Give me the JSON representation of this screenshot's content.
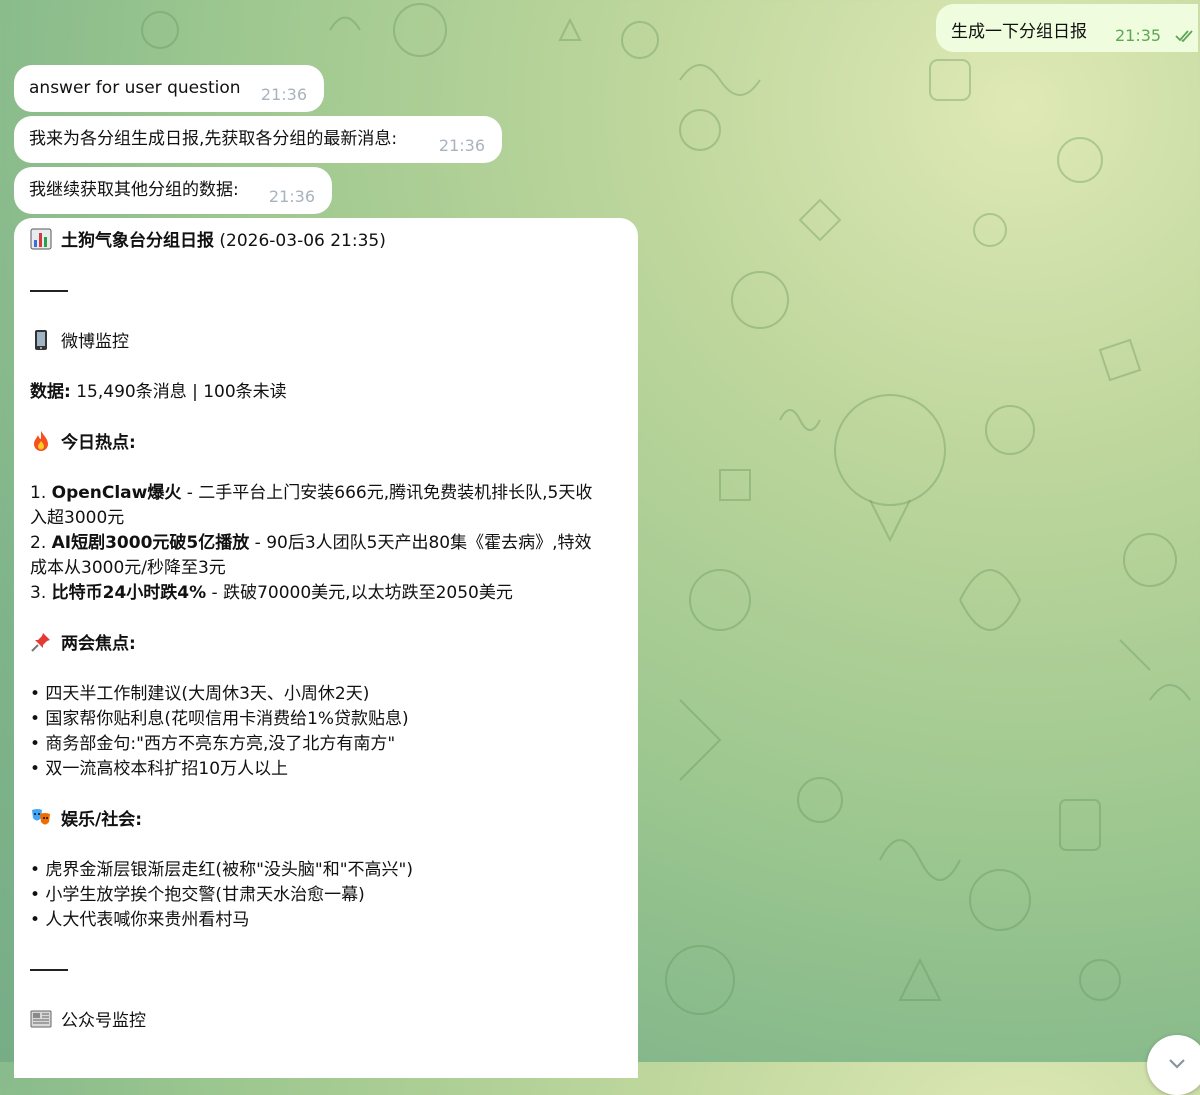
{
  "chat": {
    "outgoing": {
      "text": "生成一下分组日报",
      "time": "21:35"
    },
    "incoming": [
      {
        "text": "answer for user question",
        "time": "21:36"
      },
      {
        "text": "我来为各分组生成日报,先获取各分组的最新消息:",
        "time": "21:36"
      },
      {
        "text": "我继续获取其他分组的数据:",
        "time": "21:36"
      }
    ]
  },
  "report": {
    "title": "土狗气象台分组日报",
    "datetime": "(2026-03-06 21:35)",
    "section_weibo": "微博监控",
    "data_label": "数据:",
    "data_value": " 15,490条消息 | 100条未读",
    "hot_title": "今日热点:",
    "hot_items": [
      {
        "num": "1. ",
        "bold": "OpenClaw爆火",
        "text": " - 二手平台上门安装666元,腾讯免费装机排长队,5天收",
        "text2": "入超3000元"
      },
      {
        "num": "2. ",
        "bold": "AI短剧3000元破5亿播放",
        "text": " - 90后3人团队5天产出80集《霍去病》,特效",
        "text2": "成本从3000元/秒降至3元"
      },
      {
        "num": "3. ",
        "bold": "比特币24小时跌4%",
        "text": " - 跌破70000美元,以太坊跌至2050美元",
        "text2": ""
      }
    ],
    "lianghui_title": "两会焦点:",
    "lianghui_items": [
      "• 四天半工作制建议(大周休3天、小周休2天)",
      "• 国家帮你贴利息(花呗信用卡消费给1%贷款贴息)",
      "• 商务部金句:\"西方不亮东方亮,没了北方有南方\"",
      "• 双一流高校本科扩招10万人以上"
    ],
    "ent_title": "娱乐/社会:",
    "ent_items": [
      "• 虎界金渐层银渐层走红(被称\"没头脑\"和\"不高兴\")",
      "• 小学生放学挨个抱交警(甘肃天水治愈一幕)",
      "• 人大代表喊你来贵州看村马"
    ],
    "section_gzh": "公众号监控"
  },
  "colors": {
    "outgoing_bubble": "#effdde",
    "outgoing_time": "#5fa557",
    "incoming_time": "#a8b3be"
  }
}
